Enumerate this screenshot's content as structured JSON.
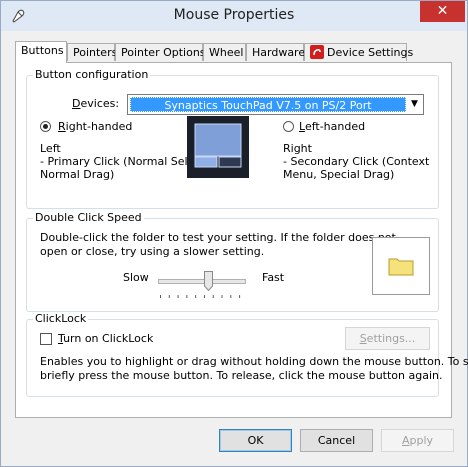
{
  "window": {
    "title": "Mouse Properties",
    "close_glyph": "✕"
  },
  "tabs": [
    {
      "label": "Buttons",
      "active": true
    },
    {
      "label": "Pointers"
    },
    {
      "label": "Pointer Options"
    },
    {
      "label": "Wheel"
    },
    {
      "label": "Hardware"
    },
    {
      "label": "Device Settings",
      "icon": "synaptics-logo-icon"
    }
  ],
  "button_config": {
    "title": "Button configuration",
    "devices_label": "Devices:",
    "device_selected": "Synaptics TouchPad V7.5 on PS/2 Port",
    "right_handed": {
      "label": "Right-handed",
      "checked": true
    },
    "left_handed": {
      "label": "Left-handed",
      "checked": false
    },
    "left_desc": [
      "Left",
      "- Primary Click (Normal Select,",
      "Normal Drag)"
    ],
    "right_desc": [
      "Right",
      "- Secondary Click (Context",
      "Menu, Special Drag)"
    ],
    "image_icon": "touchpad-icon"
  },
  "double_click": {
    "title": "Double Click Speed",
    "instructions": [
      "Double-click the folder to test your setting.  If the folder does not",
      "open or close, try using a slower setting."
    ],
    "slow_label": "Slow",
    "fast_label": "Fast",
    "speed_value": 0.58,
    "folder_icon": "folder-icon"
  },
  "clicklock": {
    "title": "ClickLock",
    "checkbox_label": "Turn on ClickLock",
    "checked": false,
    "settings_label": "Settings...",
    "description": [
      "Enables you to highlight or drag without holding down the mouse button.  To set,",
      "briefly press the mouse button.  To release, click the mouse button again."
    ]
  },
  "footer": {
    "ok_label": "OK",
    "cancel_label": "Cancel",
    "apply_label": "Apply"
  },
  "colors": {
    "selection": "#3399ff",
    "close": "#c7312e",
    "folder": "#f6e27a"
  }
}
